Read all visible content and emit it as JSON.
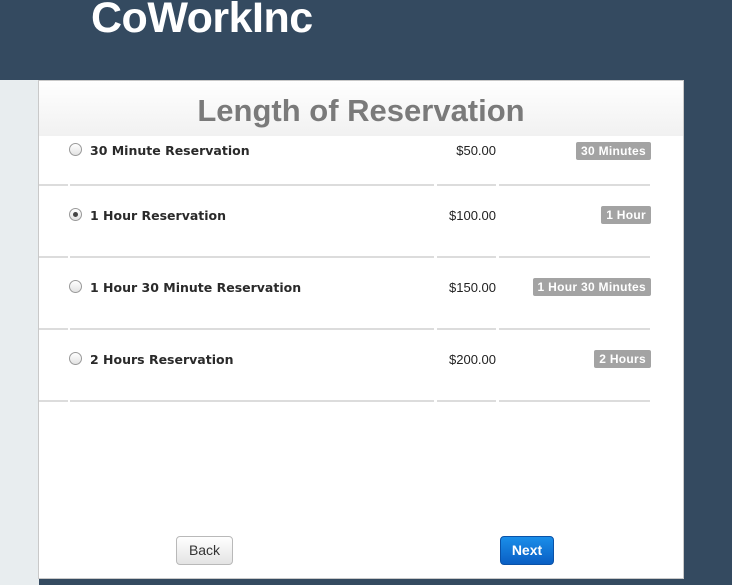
{
  "brand": "CoWorkInc",
  "page_title": "Length of Reservation",
  "options": [
    {
      "label": "30 Minute Reservation",
      "price": "$50.00",
      "badge": "30 Minutes",
      "selected": false
    },
    {
      "label": "1 Hour Reservation",
      "price": "$100.00",
      "badge": "1 Hour",
      "selected": true
    },
    {
      "label": "1 Hour 30 Minute Reservation",
      "price": "$150.00",
      "badge": "1 Hour 30 Minutes",
      "selected": false
    },
    {
      "label": "2 Hours Reservation",
      "price": "$200.00",
      "badge": "2 Hours",
      "selected": false
    }
  ],
  "buttons": {
    "back": "Back",
    "next": "Next"
  },
  "colors": {
    "background": "#344a60",
    "next_button": "#0a6fd8",
    "badge": "#a3a3a3"
  }
}
